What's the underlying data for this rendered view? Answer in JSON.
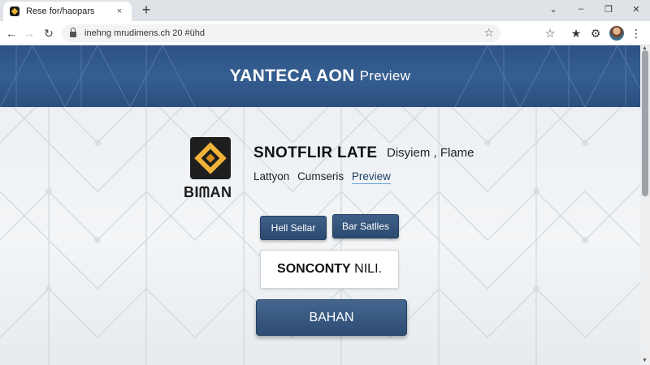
{
  "browser": {
    "tab_title": "Rese for/haopars",
    "tab_close": "×",
    "new_tab": "+",
    "url": "inehng mrudimens.ch  20 #ühd",
    "window_minimize": "–",
    "window_maximize": "❐",
    "window_close": "✕",
    "tab_list": "⌄"
  },
  "page": {
    "banner_title_main": "YANTECA AON",
    "banner_title_small": "Preview",
    "logo_text": "BIᗰAN",
    "product_title": "SNOTFLIR LATE",
    "product_subtitle": "Disyiem , Flame",
    "meta": {
      "item1": "Lattyon",
      "item2": "Cumseris",
      "preview_link": "Preview"
    },
    "button_hell": "Hell Sellar",
    "button_bar": "Bar Satlles",
    "name_box_bold": "SONCONTY",
    "name_box_rest": " NILI.",
    "main_button": "BAHAN"
  },
  "colors": {
    "banner": "#2d5283",
    "logo_accent": "#f0b33a",
    "button": "#2b4a70"
  }
}
